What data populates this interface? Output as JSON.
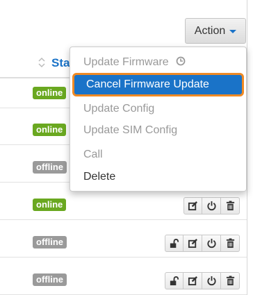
{
  "toolbar": {
    "action_label": "Action"
  },
  "table": {
    "status_header": "Sta",
    "rows": [
      {
        "status": "online",
        "kind": "online"
      },
      {
        "status": "online",
        "kind": "online"
      },
      {
        "status": "offline",
        "kind": "offline"
      },
      {
        "status": "online",
        "kind": "online"
      },
      {
        "status": "offline",
        "kind": "offline"
      },
      {
        "status": "offline",
        "kind": "offline"
      }
    ]
  },
  "menu": {
    "items": [
      {
        "label": "Update Firmware",
        "state": "disabled",
        "icon": "clock-icon"
      },
      {
        "label": "Cancel Firmware Update",
        "state": "highlighted"
      },
      {
        "label": "Update Config",
        "state": "disabled"
      },
      {
        "label": "Update SIM Config",
        "state": "disabled"
      },
      {
        "label": "Call",
        "state": "disabled"
      },
      {
        "label": "Delete",
        "state": "enabled"
      }
    ]
  },
  "colors": {
    "accent": "#1a73c8",
    "highlight_border": "#f08a24",
    "online": "#6aa820",
    "offline": "#9a9a9a"
  }
}
